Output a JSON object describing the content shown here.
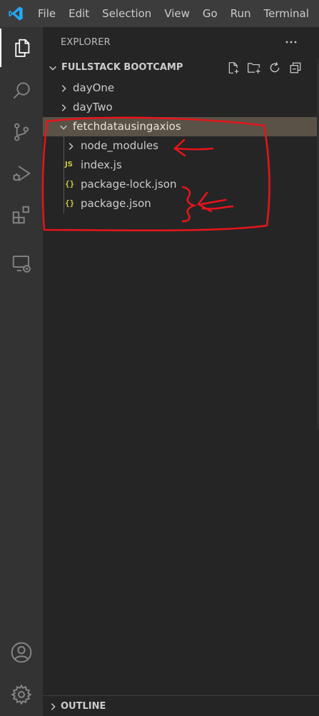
{
  "menubar": {
    "items": [
      "File",
      "Edit",
      "Selection",
      "View",
      "Go",
      "Run",
      "Terminal"
    ]
  },
  "activity_bar": {
    "items": [
      "explorer-icon",
      "search-icon",
      "source-control-icon",
      "run-debug-icon",
      "extensions-icon",
      "remote-explorer-icon"
    ],
    "bottom_items": [
      "accounts-icon",
      "manage-gear-icon"
    ],
    "active": "explorer-icon"
  },
  "sidebar": {
    "title": "EXPLORER",
    "more_actions": "···",
    "workspace": {
      "title": "FULLSTACK BOOTCAMP",
      "actions": [
        "new-file-icon",
        "new-folder-icon",
        "refresh-icon",
        "collapse-all-icon"
      ]
    },
    "tree": [
      {
        "label": "dayOne",
        "type": "folder",
        "expanded": false
      },
      {
        "label": "dayTwo",
        "type": "folder",
        "expanded": false
      },
      {
        "label": "fetchdatausingaxios",
        "type": "folder",
        "expanded": true,
        "selected": true
      },
      {
        "label": "node_modules",
        "type": "folder",
        "expanded": false
      },
      {
        "label": "index.js",
        "type": "file",
        "icon": "JS"
      },
      {
        "label": "package-lock.json",
        "type": "file",
        "icon": "{}"
      },
      {
        "label": "package.json",
        "type": "file",
        "icon": "{}"
      }
    ],
    "outline": {
      "title": "OUTLINE"
    }
  },
  "colors": {
    "menubar": "#3c3c3c",
    "activity_bar": "#333333",
    "sidebar": "#252526",
    "selected_row": "#5a5247",
    "annotation": "#e8141a",
    "file_icon": "#cbcb41",
    "logo": "#23a9f2"
  }
}
